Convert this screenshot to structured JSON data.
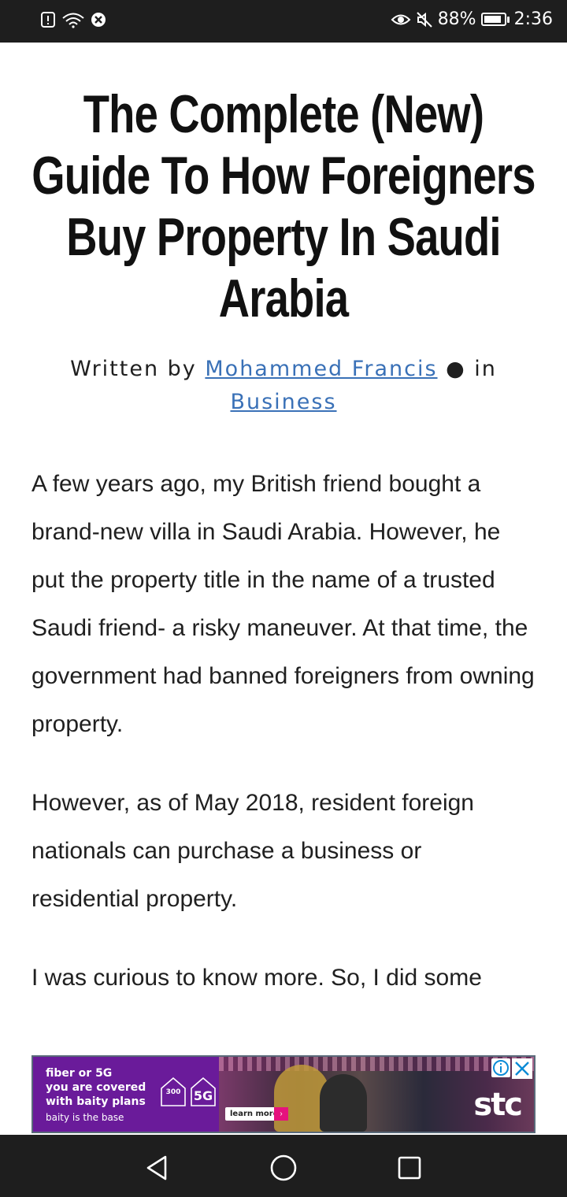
{
  "status_bar": {
    "battery_percent": "88%",
    "time": "2:36",
    "battery_level": 0.88,
    "left_icons": [
      "alert-icon",
      "wifi-icon",
      "shield-icon"
    ],
    "right_icons": [
      "eye-icon",
      "mute-icon",
      "battery-icon"
    ]
  },
  "article": {
    "title": "The Complete (New) Guide To How Foreigners Buy Property In Saudi Arabia",
    "byline": {
      "written_by": "Written by",
      "author": "Mohammed Francis",
      "bullet": "●",
      "in": "in",
      "category": "Business"
    },
    "paragraphs": [
      "A few years ago, my British friend bought a brand-new villa in Saudi Arabia. However, he put the property title in the name of a trusted Saudi friend- a risky maneuver. At that time, the government had banned foreigners from owning property.",
      "However, as of May 2018, resident foreign nationals can purchase a business or residential property.",
      "I was curious to know more. So, I did some"
    ],
    "colors": {
      "link": "#3a71b7",
      "text": "#202020"
    }
  },
  "ad": {
    "line1": "fiber or 5G",
    "line2": "you are covered",
    "line3": "with baity plans",
    "line4": "baity is the base",
    "badge_300": "300",
    "badge_5g": "5G",
    "learn_more": "learn more",
    "brand": "stc",
    "colors": {
      "purple": "#6a1b9a",
      "accent": "#e5127d"
    }
  },
  "nav_bar": {
    "buttons": [
      "back-icon",
      "home-icon",
      "recents-icon"
    ]
  }
}
